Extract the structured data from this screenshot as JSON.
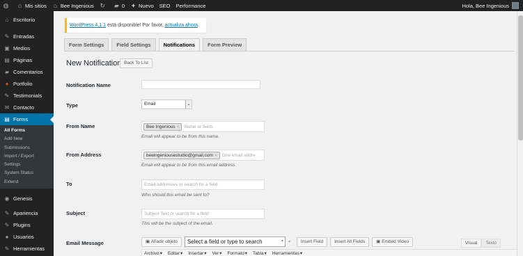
{
  "adminbar": {
    "mysites": "Mis sitios",
    "site": "Bee Ingenious",
    "comments": "0",
    "new": "Nuevo",
    "seo": "SEO",
    "performance": "Performance",
    "greeting": "Hola, Bee Ingenious"
  },
  "sidebar": {
    "items": [
      {
        "label": "Escritorio",
        "icon": "⌂"
      },
      {
        "label": "Entradas",
        "icon": "✎"
      },
      {
        "label": "Medios",
        "icon": "▣"
      },
      {
        "label": "Páginas",
        "icon": "▤"
      },
      {
        "label": "Comentarios",
        "icon": "▰"
      },
      {
        "label": "Portfolio",
        "icon": "●"
      },
      {
        "label": "Testimonials",
        "icon": "✎"
      },
      {
        "label": "Contacto",
        "icon": "✉"
      },
      {
        "label": "Forms",
        "icon": "▤"
      }
    ],
    "submenu": [
      "All Forms",
      "Add New",
      "Submissions",
      "Import / Export",
      "Settings",
      "System Status",
      "Extend"
    ],
    "bottom_items": [
      {
        "label": "Genesis",
        "icon": "◉"
      },
      {
        "label": "Apariencia",
        "icon": "✎"
      },
      {
        "label": "Plugins",
        "icon": "✎"
      },
      {
        "label": "Usuarios",
        "icon": "●"
      },
      {
        "label": "Herramientas",
        "icon": "✎"
      }
    ]
  },
  "notice": {
    "link1": "WordPress 4.1.1",
    "mid": " está disponible! Por favor, ",
    "link2": "actualiza ahora",
    "end": "."
  },
  "tabs": [
    "Form Settings",
    "Field Settings",
    "Notifications",
    "Form Preview"
  ],
  "heading": "New Notification",
  "back_button": "Back To List",
  "form": {
    "name_label": "Notification Name",
    "type_label": "Type",
    "type_value": "Email",
    "from_name_label": "From Name",
    "from_name_token": "Bee Ingenious",
    "from_name_placeholder": "Name or fields",
    "from_name_desc": "Email will appear to be from this name.",
    "from_address_label": "From Address",
    "from_address_token": "beeingeniousestudio@gmail.com",
    "from_address_placeholder": "One email addre",
    "from_address_desc": "Email will appear to be from this email address.",
    "to_label": "To",
    "to_placeholder": "Email addresses or search for a field",
    "to_desc": "Who should this email be sent to?",
    "subject_label": "Subject",
    "subject_placeholder": "Subject Text or search for a field",
    "subject_desc": "This will be the subject of the email.",
    "message_label": "Email Message"
  },
  "editor": {
    "add_media": "Añadir objeto",
    "field_select": "Select a field or type to search",
    "insert_field": "Insert Field",
    "insert_all": "Insert All Fields",
    "embed_video": "Embed Video",
    "visual": "Visual",
    "text": "Texto",
    "menu": [
      "Archivo",
      "Editar",
      "Insertar",
      "Ver",
      "Formato",
      "Tabla",
      "Herramientas"
    ]
  }
}
